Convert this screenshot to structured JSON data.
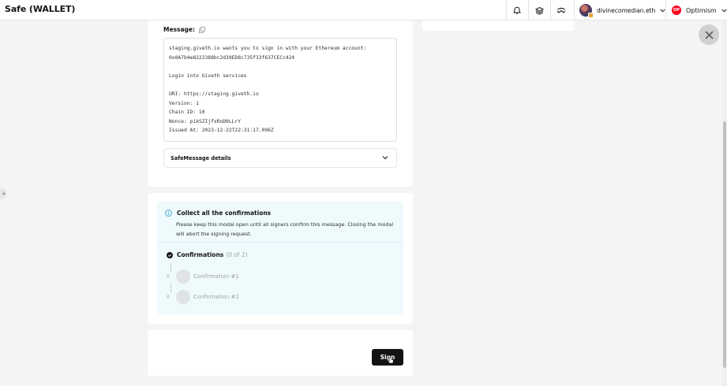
{
  "app": {
    "title": "Safe (WALLET)"
  },
  "topbar": {
    "icons": [
      "bell-icon",
      "stack-icon",
      "walletconnect-icon"
    ],
    "account": {
      "name": "divinecomedian.eth"
    },
    "network": {
      "name": "Optimism",
      "logo_text": "OP",
      "color": "#ff0420"
    }
  },
  "message_card": {
    "label": "Message:",
    "text": "staging.giveth.io wants you to sign in with your Ethereum account:\n0x0A7b4e8222388bc2d39ED8c735f33f637CECc424\n\nLogin into Giveth services\n\nURI: https://staging.giveth.io\nVersion: 1\nChain ID: 10\nNonce: pikSZIjfxRnD0LLrY\nIssued At: 2023-12-22T22:31:17.096Z",
    "details_label": "SafeMessage details"
  },
  "confirmations": {
    "info_title": "Collect all the confirmations",
    "info_text": "Please keep this modal open until all signers confirm this message. Closing the modal will abort the signing request.",
    "title": "Confirmations",
    "count": "(0 of 2)",
    "items": [
      {
        "num": "0",
        "label": "Confirmation #1"
      },
      {
        "num": "0",
        "label": "Confirmation #2"
      }
    ]
  },
  "actions": {
    "sign_label": "Sign"
  },
  "colors": {
    "accent": "#12ff80",
    "info_bg": "#effafd",
    "button_bg": "#121312"
  }
}
